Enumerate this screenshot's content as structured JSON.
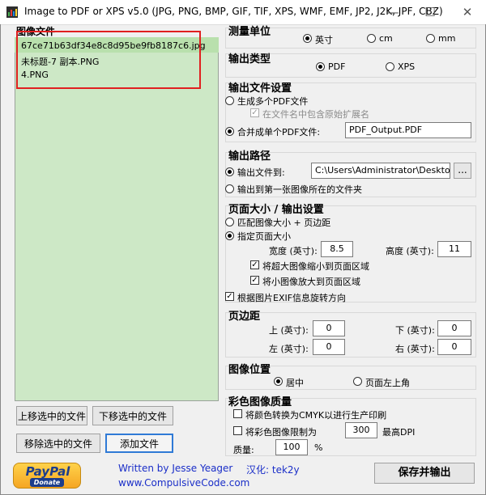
{
  "window": {
    "title": "Image to PDF or XPS  v5.0  (JPG, PNG, BMP, GIF, TIF, XPS, WMF, EMF, JP2, J2K, JPF, CBZ)"
  },
  "files": {
    "label": "图像文件",
    "items": [
      "67ce71b63df34e8c8d95be9fb8187c6.jpg",
      "未标题-7 副本.PNG",
      "4.PNG"
    ]
  },
  "buttons": {
    "move_up": "上移选中的文件",
    "move_down": "下移选中的文件",
    "remove": "移除选中的文件",
    "add": "添加文件",
    "save": "保存并输出",
    "browse": "..."
  },
  "footer": {
    "paypal": "PayPal",
    "donate": "Donate",
    "author": "Written by Jesse Yeager",
    "site": "www.CompulsiveCode.com",
    "localized": "汉化: tek2y"
  },
  "units": {
    "title": "测量单位",
    "inch": "英寸",
    "cm": "cm",
    "mm": "mm",
    "selected": "inch"
  },
  "output_type": {
    "title": "输出类型",
    "pdf": "PDF",
    "xps": "XPS",
    "selected": "pdf"
  },
  "file_settings": {
    "title": "输出文件设置",
    "multi": "生成多个PDF文件",
    "keep_ext": "在文件名中包含原始扩展名",
    "single": "合并成单个PDF文件:",
    "filename": "PDF_Output.PDF"
  },
  "output_path": {
    "title": "输出路径",
    "to_folder": "输出文件到:",
    "folder": "C:\\Users\\Administrator\\Desktop",
    "first_image_folder": "输出到第一张图像所在的文件夹"
  },
  "page_size": {
    "title": "页面大小 / 输出设置",
    "match": "匹配图像大小 + 页边距",
    "specify": "指定页面大小",
    "width_label": "宽度 (英寸):",
    "width": "8.5",
    "height_label": "高度 (英寸):",
    "height": "11",
    "shrink": "将超大图像缩小到页面区域",
    "enlarge": "将小图像放大到页面区域",
    "exif": "根据图片EXIF信息旋转方向"
  },
  "margins": {
    "title": "页边距",
    "top_label": "上 (英寸):",
    "top": "0",
    "bottom_label": "下 (英寸):",
    "bottom": "0",
    "left_label": "左 (英寸):",
    "left": "0",
    "right_label": "右 (英寸):",
    "right": "0"
  },
  "position": {
    "title": "图像位置",
    "center": "居中",
    "top_left": "页面左上角",
    "selected": "center"
  },
  "color": {
    "title": "彩色图像质量",
    "cmyk": "将颜色转换为CMYK以进行生产印刷",
    "limit": "将彩色图像限制为",
    "dpi": "300",
    "dpi_label": "最高DPI",
    "quality_label": "质量:",
    "quality": "100",
    "percent": "%"
  },
  "colors": {
    "list_bg": "#cde8c6",
    "highlight_border": "#e02020",
    "link": "#1a2ec8",
    "paypal_blue": "#1c3d8c"
  }
}
